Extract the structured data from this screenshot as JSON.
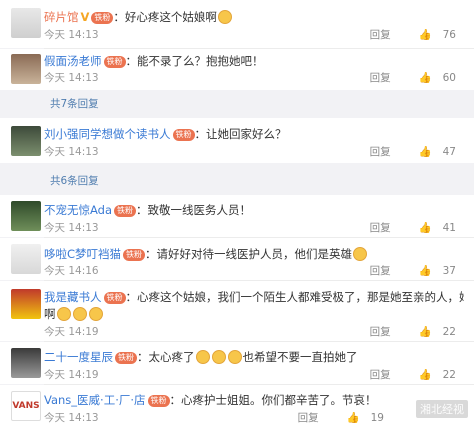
{
  "comments": [
    {
      "name": "碎片馆",
      "verified": true,
      "badge": "铁粉",
      "text": "好心疼这个姑娘啊",
      "emojis": 1,
      "time": "今天 14:13",
      "reply": "回复",
      "likes": "76"
    },
    {
      "name": "假面汤老师",
      "verified": false,
      "badge": "铁粉",
      "text": "能不录了么？抱抱她吧！",
      "emojis": 0,
      "time": "今天 14:13",
      "reply": "回复",
      "likes": "60"
    },
    {
      "name": "刘小强同学想做个读书人",
      "verified": false,
      "badge": "铁粉",
      "text": "让她回家好么？",
      "emojis": 0,
      "time": "今天 14:13",
      "reply": "回复",
      "likes": "47"
    },
    {
      "name": "不宠无惊Ada",
      "verified": false,
      "badge": "铁粉",
      "text": "致敬一线医务人员！",
      "emojis": 0,
      "time": "今天 14:13",
      "reply": "回复",
      "likes": "41"
    },
    {
      "name": "哆啦C梦叮裆猫",
      "verified": false,
      "badge": "铁粉",
      "text": "请好好对待一线医护人员，他们是英雄",
      "emojis": 1,
      "time": "今天 14:16",
      "reply": "回复",
      "likes": "37"
    },
    {
      "name": "我是藏书人",
      "verified": false,
      "badge": "铁粉",
      "text": "心疼这个姑娘，我们一个陌生人都难受极了，那是她至亲的人，她得多难受",
      "text2": "啊",
      "emojis": 3,
      "time": "今天 14:19",
      "reply": "回复",
      "likes": "22"
    },
    {
      "name": "二十一度星辰",
      "verified": false,
      "badge": "铁粉",
      "text": "太心疼了",
      "text_b": "也希望不要一直拍她了",
      "emojis": 3,
      "time": "今天 14:19",
      "reply": "回复",
      "likes": "22"
    },
    {
      "name": "Vans_医威·工·厂·店",
      "verified": false,
      "badge": "铁粉",
      "text": "心疼护士姐姐。你们都辛苦了。节哀！",
      "emojis": 0,
      "time": "今天 14:13",
      "reply": "回复",
      "likes": "19"
    }
  ],
  "more_replies": [
    "共7条回复",
    "共6条回复"
  ],
  "watermark": "湘北经视",
  "colors": {
    "name": "#eb7350",
    "link": "#507daf",
    "badge": "#eb7350"
  }
}
